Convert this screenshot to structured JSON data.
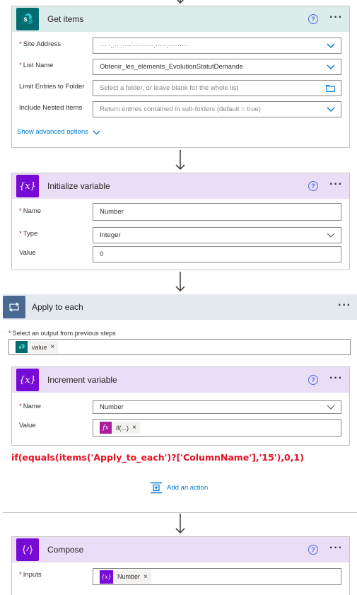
{
  "get_items": {
    "title": "Get items",
    "site_address_label": "Site Address",
    "site_address_value": "··· ·,,·· ,···· ·········,·····,·········",
    "list_name_label": "List Name",
    "list_name_value": "Obtenir_les_éléments_EvolutionStatutDemande",
    "limit_folder_label": "Limit Entries to Folder",
    "limit_folder_placeholder": "Select a folder, or leave blank for the whole list",
    "nested_items_label": "Include Nested Items",
    "nested_items_placeholder": "Return entries contained in sub-folders (default = true)",
    "advanced_options": "Show advanced options",
    "colors": {
      "header_bg": "#dcecea",
      "icon_bg": "#036c70"
    }
  },
  "initialize_variable": {
    "title": "Initialize variable",
    "name_label": "Name",
    "name_value": "Number",
    "type_label": "Type",
    "type_value": "Integer",
    "value_label": "Value",
    "value_value": "0",
    "colors": {
      "header_bg": "#e9def5",
      "icon_bg": "#770bd6"
    }
  },
  "apply_to_each": {
    "title": "Apply to each",
    "select_label": "Select an output from previous steps",
    "token_label": "value",
    "colors": {
      "header_bg": "#e4e9ef",
      "icon_bg": "#486991"
    }
  },
  "increment_variable": {
    "title": "Increment variable",
    "name_label": "Name",
    "name_value": "Number",
    "value_label": "Value",
    "token_label": "if(...)",
    "fx_glyph": "fx",
    "colors": {
      "header_bg": "#e9def5",
      "icon_bg": "#770bd6",
      "fx_bg": "#ab1e9c"
    }
  },
  "expression_annotation": "if(equals(items('Apply_to_each')?['ColumnName'],'15'),0,1)",
  "add_action": "Add an action",
  "compose": {
    "title": "Compose",
    "inputs_label": "Inputs",
    "token_label": "Number",
    "colors": {
      "header_bg": "#e9def5",
      "icon_bg": "#770bd6"
    }
  },
  "glyphs": {
    "required": "*",
    "help": "?",
    "more": "···",
    "close": "×",
    "variable": "{x}"
  }
}
